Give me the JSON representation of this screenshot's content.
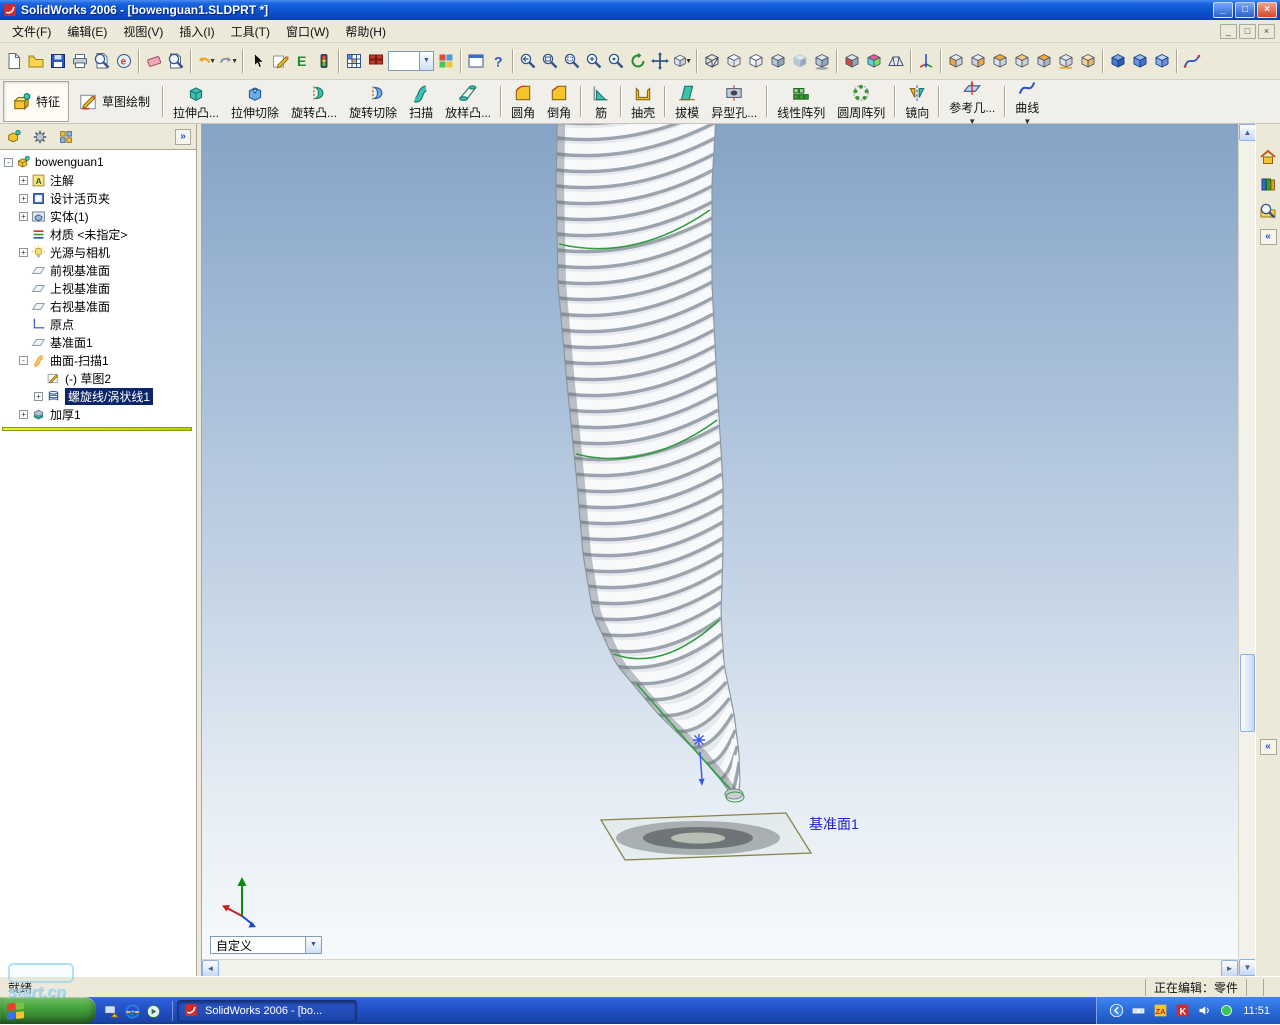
{
  "window": {
    "title": "SolidWorks 2006 - [bowenguan1.SLDPRT *]"
  },
  "menu": {
    "items": [
      "文件(F)",
      "编辑(E)",
      "视图(V)",
      "插入(I)",
      "工具(T)",
      "窗口(W)",
      "帮助(H)"
    ]
  },
  "toolbar1": [
    {
      "name": "new-icon",
      "glyph": "page"
    },
    {
      "name": "open-icon",
      "glyph": "folder"
    },
    {
      "name": "save-icon",
      "glyph": "disk"
    },
    {
      "name": "print-icon",
      "glyph": "printer"
    },
    {
      "name": "print-preview-icon",
      "glyph": "preview"
    },
    {
      "name": "publish-edrawings-icon",
      "glyph": "edraw"
    },
    {
      "sep": true
    },
    {
      "name": "delete-icon",
      "glyph": "eraser"
    },
    {
      "name": "document-zoom-icon",
      "glyph": "magpage"
    },
    {
      "sep": true
    },
    {
      "name": "undo-icon",
      "glyph": "undo",
      "dd": true
    },
    {
      "name": "redo-icon",
      "glyph": "redo",
      "dd": true
    },
    {
      "sep": true
    },
    {
      "name": "select-icon",
      "glyph": "cursor"
    },
    {
      "name": "sketch-icon",
      "glyph": "pencil"
    },
    {
      "name": "edrawings-icon",
      "glyph": "greenE"
    },
    {
      "name": "display-states-icon",
      "glyph": "traffic"
    },
    {
      "sep": true
    },
    {
      "name": "design-table-icon",
      "glyph": "gridc"
    },
    {
      "name": "bom-table-icon",
      "glyph": "gridr"
    },
    {
      "name": "selection-filter-combo",
      "glyph": "combo",
      "combo": true
    },
    {
      "name": "edit-color-icon",
      "glyph": "paint"
    },
    {
      "sep": true
    },
    {
      "name": "window-layout-icon",
      "glyph": "layout"
    },
    {
      "name": "help-icon",
      "glyph": "help"
    },
    {
      "sep": true
    },
    {
      "name": "view-previous-icon",
      "glyph": "magprev"
    },
    {
      "name": "zoom-to-fit-icon",
      "glyph": "magfit"
    },
    {
      "name": "zoom-to-area-icon",
      "glyph": "magarea"
    },
    {
      "name": "zoom-in-out-icon",
      "glyph": "magio"
    },
    {
      "name": "zoom-to-selection-icon",
      "glyph": "magsel"
    },
    {
      "name": "rotate-view-icon",
      "glyph": "rotate"
    },
    {
      "name": "pan-icon",
      "glyph": "pan"
    },
    {
      "name": "view-orientation-icon",
      "glyph": "cubeor",
      "dd": true
    },
    {
      "sep": true
    },
    {
      "name": "wireframe-icon",
      "glyph": "cubewire"
    },
    {
      "name": "hidden-lines-visible-icon",
      "glyph": "cubehlv"
    },
    {
      "name": "hidden-lines-removed-icon",
      "glyph": "cubehlr"
    },
    {
      "name": "shaded-with-edges-icon",
      "glyph": "cubese"
    },
    {
      "name": "shaded-icon",
      "glyph": "cubesh"
    },
    {
      "name": "shadows-icon",
      "glyph": "cubeshadow"
    },
    {
      "sep": true
    },
    {
      "name": "section-view-icon",
      "glyph": "cubesection"
    },
    {
      "name": "curvature-icon",
      "glyph": "cubecurv"
    },
    {
      "name": "perspective-icon",
      "glyph": "cubepersp"
    },
    {
      "sep": true
    },
    {
      "name": "reference-triad-icon",
      "glyph": "axisdown"
    },
    {
      "sep": true
    },
    {
      "name": "front-view-icon",
      "glyph": "cubeF"
    },
    {
      "name": "back-view-icon",
      "glyph": "cubeB"
    },
    {
      "name": "left-view-icon",
      "glyph": "cubeL"
    },
    {
      "name": "right-view-icon",
      "glyph": "cubeR"
    },
    {
      "name": "top-view-icon",
      "glyph": "cubeT"
    },
    {
      "name": "bottom-view-icon",
      "glyph": "cubeBot"
    },
    {
      "name": "isometric-view-icon",
      "glyph": "cubeIso"
    },
    {
      "sep": true
    },
    {
      "name": "normal-to-icon",
      "glyph": "bluecube1"
    },
    {
      "name": "dimetric-view-icon",
      "glyph": "bluecube2"
    },
    {
      "name": "trimetric-view-icon",
      "glyph": "bluecube3"
    },
    {
      "sep": true
    },
    {
      "name": "curve-icon",
      "glyph": "spline"
    }
  ],
  "feature_toolbar": [
    {
      "label": "特征",
      "name": "features-tab-button",
      "glyph": "feat",
      "active": true,
      "wide": true
    },
    {
      "label": "草图绘制",
      "name": "sketch-tab-button",
      "glyph": "sketchbtn",
      "wide": true
    },
    {
      "sep": true
    },
    {
      "label": "拉伸凸...",
      "name": "extruded-boss-button",
      "glyph": "extrude"
    },
    {
      "label": "拉伸切除",
      "name": "extruded-cut-button",
      "glyph": "extcut"
    },
    {
      "label": "旋转凸...",
      "name": "revolved-boss-button",
      "glyph": "revolve"
    },
    {
      "label": "旋转切除",
      "name": "revolved-cut-button",
      "glyph": "revcut"
    },
    {
      "label": "扫描",
      "name": "sweep-button",
      "glyph": "sweep"
    },
    {
      "label": "放样凸...",
      "name": "loft-button",
      "glyph": "loft"
    },
    {
      "sep": true
    },
    {
      "label": "圆角",
      "name": "fillet-button",
      "glyph": "fillet"
    },
    {
      "label": "倒角",
      "name": "chamfer-button",
      "glyph": "chamfer"
    },
    {
      "sep": true
    },
    {
      "label": "筋",
      "name": "rib-button",
      "glyph": "rib"
    },
    {
      "sep": true
    },
    {
      "label": "抽壳",
      "name": "shell-button",
      "glyph": "shell"
    },
    {
      "sep": true
    },
    {
      "label": "拔模",
      "name": "draft-button",
      "glyph": "draft"
    },
    {
      "label": "异型孔...",
      "name": "hole-wizard-button",
      "glyph": "hole"
    },
    {
      "sep": true
    },
    {
      "label": "线性阵列",
      "name": "linear-pattern-button",
      "glyph": "linpat"
    },
    {
      "label": "圆周阵列",
      "name": "circular-pattern-button",
      "glyph": "cirpat"
    },
    {
      "sep": true
    },
    {
      "label": "镜向",
      "name": "mirror-button",
      "glyph": "mirror"
    },
    {
      "sep": true
    },
    {
      "label": "参考几...",
      "name": "reference-geometry-button",
      "glyph": "refgeo",
      "dd": true
    },
    {
      "sep": true
    },
    {
      "label": "曲线",
      "name": "curves-button",
      "glyph": "curve",
      "dd": true
    }
  ],
  "tree": {
    "tabs": [
      {
        "name": "featuremanager-tab-icon",
        "glyph": "tabFM"
      },
      {
        "name": "propertymanager-tab-icon",
        "glyph": "tabPM"
      },
      {
        "name": "configurationmanager-tab-icon",
        "glyph": "tabCM"
      }
    ],
    "items": [
      {
        "label": "bowenguan1",
        "icon": "part-icon",
        "glyph": "part",
        "indent": 0,
        "exp": "-"
      },
      {
        "label": "注解",
        "icon": "annotations-icon",
        "glyph": "ann",
        "indent": 1,
        "exp": "+"
      },
      {
        "label": "设计活页夹",
        "icon": "design-binder-icon",
        "glyph": "binder",
        "indent": 1,
        "exp": "+"
      },
      {
        "label": "实体(1)",
        "icon": "solid-bodies-icon",
        "glyph": "bodies",
        "indent": 1,
        "exp": "+"
      },
      {
        "label": "材质 <未指定>",
        "icon": "material-icon",
        "glyph": "material",
        "indent": 1,
        "exp": ""
      },
      {
        "label": "光源与相机",
        "icon": "lights-cameras-icon",
        "glyph": "light",
        "indent": 1,
        "exp": "+"
      },
      {
        "label": "前视基准面",
        "icon": "plane-icon",
        "glyph": "plane",
        "indent": 1,
        "exp": ""
      },
      {
        "label": "上视基准面",
        "icon": "plane-icon",
        "glyph": "plane",
        "indent": 1,
        "exp": ""
      },
      {
        "label": "右视基准面",
        "icon": "plane-icon",
        "glyph": "plane",
        "indent": 1,
        "exp": ""
      },
      {
        "label": "原点",
        "icon": "origin-icon",
        "glyph": "origin",
        "indent": 1,
        "exp": ""
      },
      {
        "label": "基准面1",
        "icon": "plane-icon",
        "glyph": "plane",
        "indent": 1,
        "exp": ""
      },
      {
        "label": "曲面-扫描1",
        "icon": "surface-sweep-icon",
        "glyph": "sweepsurf",
        "indent": 1,
        "exp": "-"
      },
      {
        "label": "(-) 草图2",
        "icon": "sketch-icon",
        "glyph": "sketch2",
        "indent": 2,
        "exp": ""
      },
      {
        "label": "螺旋线/涡状线1",
        "icon": "helix-icon",
        "glyph": "helix",
        "indent": 2,
        "exp": "+",
        "selected": true
      },
      {
        "label": "加厚1",
        "icon": "thicken-icon",
        "glyph": "thicken",
        "indent": 1,
        "exp": "+"
      }
    ]
  },
  "viewport": {
    "plane_label": "基准面1",
    "view_combo": "自定义"
  },
  "task_pane": {
    "icons": [
      {
        "name": "solidworks-resources-icon",
        "glyph": "tsHome"
      },
      {
        "name": "design-library-icon",
        "glyph": "tsBooks"
      },
      {
        "name": "file-explorer-icon",
        "glyph": "tsSearch"
      }
    ]
  },
  "status": {
    "ready": "就绪",
    "editing": "正在编辑：零件"
  },
  "taskbar": {
    "quick_launch": [
      {
        "name": "show-desktop-icon",
        "glyph": "qDesktop"
      },
      {
        "name": "internet-explorer-icon",
        "glyph": "qIE"
      },
      {
        "name": "media-player-icon",
        "glyph": "qMedia"
      }
    ],
    "task_label": "SolidWorks 2006 - [bo...",
    "tray": [
      {
        "name": "tray-chevron-icon",
        "glyph": "trChevron"
      },
      {
        "name": "network-icon",
        "glyph": "trNet"
      },
      {
        "name": "zonealarm-icon",
        "glyph": "trZA"
      },
      {
        "name": "antivirus-icon",
        "glyph": "trK"
      },
      {
        "name": "volume-icon",
        "glyph": "trVol"
      },
      {
        "name": "status-icon",
        "glyph": "trGreen"
      }
    ],
    "time": "11:51"
  },
  "watermark": {
    "text": "start.cn"
  }
}
